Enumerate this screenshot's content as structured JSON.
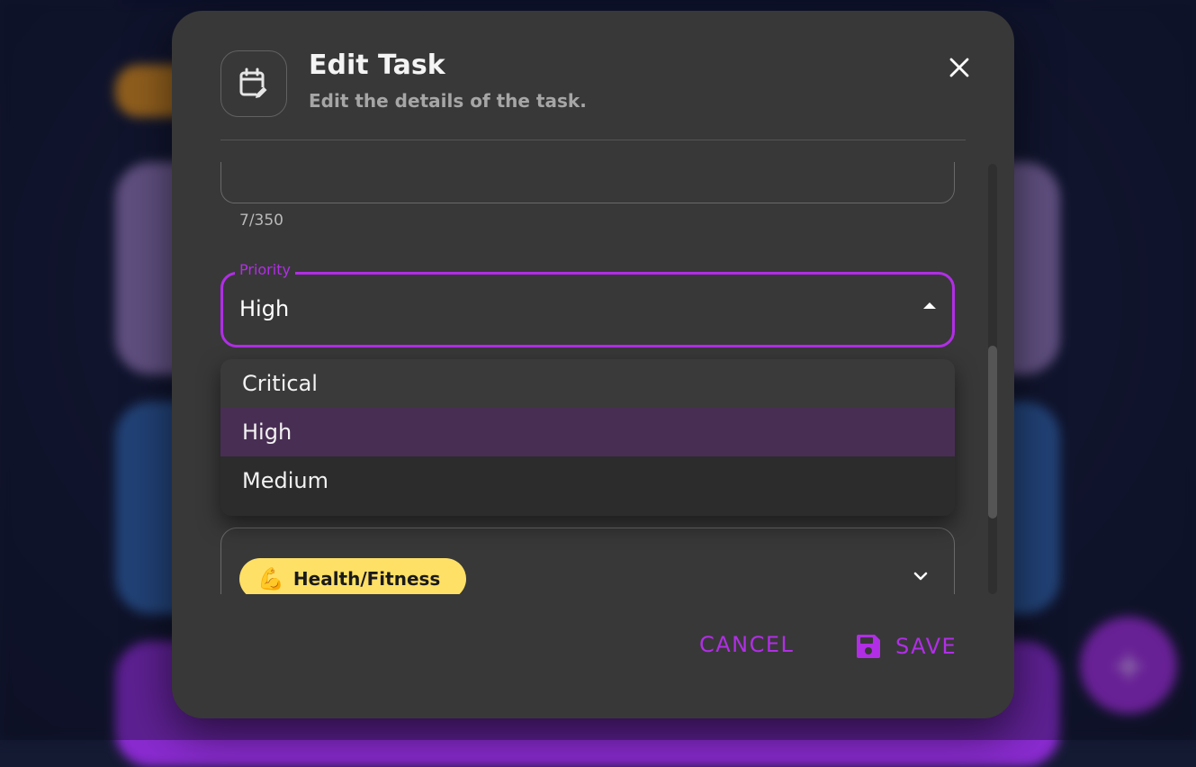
{
  "background": {
    "fab_label": "+"
  },
  "dialog": {
    "title": "Edit Task",
    "subtitle": "Edit the details of the task.",
    "icon": "calendar-edit-icon",
    "close_icon": "close-icon",
    "description": {
      "char_counter": "7/350"
    },
    "priority": {
      "label": "Priority",
      "value": "High",
      "options": [
        "Critical",
        "High",
        "Medium"
      ],
      "selected_index": 1
    },
    "category": {
      "chip_emoji": "💪",
      "chip_label": "Health/Fitness",
      "chip_color": "#ffe066"
    },
    "actions": {
      "cancel_label": "CANCEL",
      "save_label": "SAVE"
    }
  },
  "colors": {
    "accent": "#b12ee6",
    "dialog_bg": "#383838",
    "selected_option_bg": "#492e54"
  }
}
